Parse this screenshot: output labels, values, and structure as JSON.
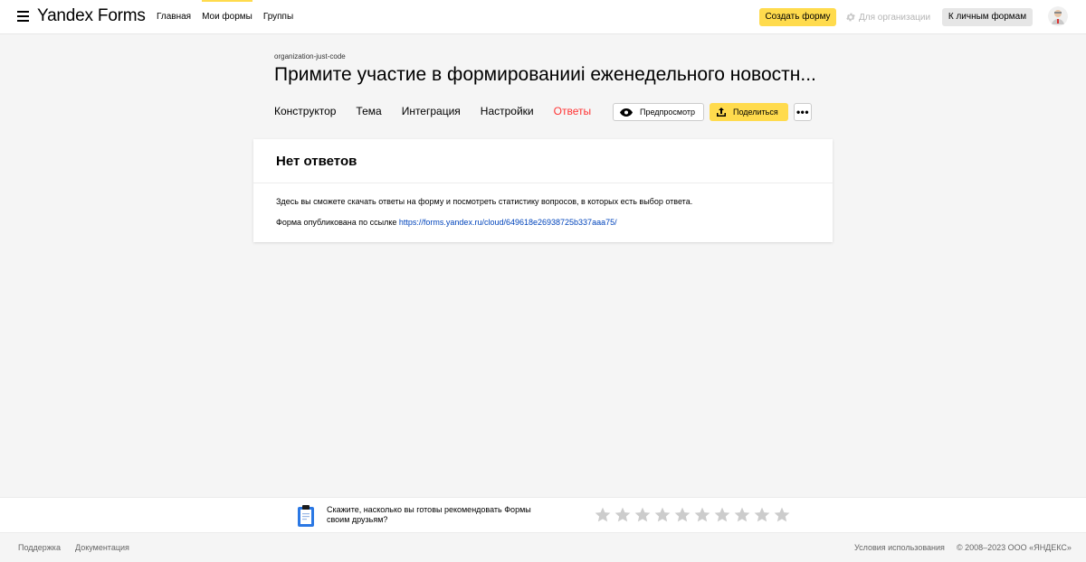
{
  "header": {
    "logo": "Yandex Forms",
    "nav": [
      "Главная",
      "Мои формы",
      "Группы"
    ],
    "create_button": "Создать форму",
    "org_link": "Для организации",
    "personal_button": "К личным формам"
  },
  "form": {
    "org": "organization-just-code",
    "title": "Примите участие в формированииi еженедельного новостн...",
    "tabs": [
      "Конструктор",
      "Тема",
      "Интеграция",
      "Настройки",
      "Ответы"
    ],
    "preview_button": "Предпросмотр",
    "share_button": "Поделиться",
    "more_button": "•••"
  },
  "card": {
    "title": "Нет ответов",
    "text": "Здесь вы сможете скачать ответы на форму и посмотреть статистику вопросов, в которых есть выбор ответа.",
    "link_prefix": "Форма опубликована по ссылке ",
    "link": "https://forms.yandex.ru/cloud/649618e26938725b337aaa75/"
  },
  "feedback": {
    "text": "Скажите, насколько вы готовы рекомендовать Формы своим друзьям?",
    "stars_count": 10
  },
  "footer": {
    "support": "Поддержка",
    "docs": "Документация",
    "terms": "Условия использования",
    "copyright": "© 2008–2023 ООО «ЯНДЕКС»"
  },
  "colors": {
    "accent": "#ffdb4d",
    "active_tab": "#ff3333",
    "link": "#0044bb",
    "star": "#cccccc"
  }
}
